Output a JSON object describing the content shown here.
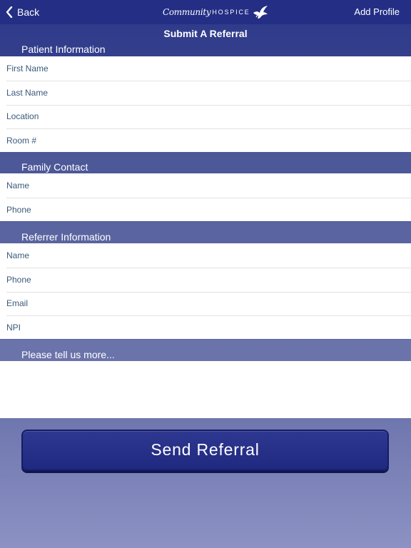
{
  "nav": {
    "back_label": "Back",
    "logo_script": "Community",
    "logo_caps": "HOSPICE",
    "add_profile_label": "Add Profile"
  },
  "title": "Submit A Referral",
  "sections": {
    "patient": {
      "header": "Patient Information",
      "fields": [
        "First Name",
        "Last Name",
        "Location",
        "Room #"
      ]
    },
    "family": {
      "header": "Family Contact",
      "fields": [
        "Name",
        "Phone"
      ]
    },
    "referrer": {
      "header": "Referrer Information",
      "fields": [
        "Name",
        "Phone",
        "Email",
        "NPI"
      ]
    },
    "more": {
      "header": "Please tell us more..."
    }
  },
  "send_button_label": "Send Referral",
  "icons": {
    "back": "chevron-left-icon",
    "logo": "dove-icon"
  },
  "colors": {
    "navbar": "#232e84",
    "button": "#232e84",
    "field_text": "#3a5a7a"
  }
}
